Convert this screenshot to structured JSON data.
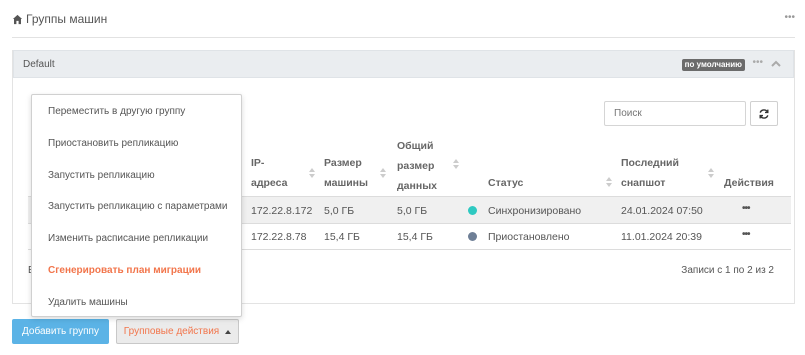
{
  "header": {
    "icon": "home-icon",
    "title": "Группы машин",
    "more": "•••"
  },
  "panel": {
    "title": "Default",
    "badge": "по умолчанию",
    "more": "•••",
    "collapse_icon": "chevron-up-icon"
  },
  "search": {
    "placeholder": "Поиск",
    "value": ""
  },
  "refresh_icon": "refresh-icon",
  "table": {
    "columns": {
      "ip": [
        "IP-",
        "адреса"
      ],
      "size": [
        "Размер",
        "машины"
      ],
      "total": [
        "Общий",
        "размер",
        "данных"
      ],
      "status": "Статус",
      "snapshot": [
        "Последний",
        "снапшот"
      ],
      "actions": "Действия"
    },
    "rows": [
      {
        "ip": "172.22.8.172",
        "size": "5,0 ГБ",
        "total": "5,0 ГБ",
        "status": "Синхронизировано",
        "status_color": "#2ec9c1",
        "snapshot": "24.01.2024 07:50",
        "actions": "•••"
      },
      {
        "ip": "172.22.8.78",
        "size": "15,4 ГБ",
        "total": "15,4 ГБ",
        "status": "Приостановлено",
        "status_color": "#6e7f96",
        "snapshot": "11.01.2024 20:39",
        "actions": "•••"
      }
    ]
  },
  "footer": {
    "partial_left": "E",
    "records": "Записи с 1 по 2 из 2"
  },
  "menu": {
    "items": [
      {
        "label": "Переместить в другую группу",
        "accent": false
      },
      {
        "label": "Приостановить репликацию",
        "accent": false
      },
      {
        "label": "Запустить репликацию",
        "accent": false
      },
      {
        "label": "Запустить репликацию с параметрами",
        "accent": false
      },
      {
        "label": "Изменить расписание репликации",
        "accent": false
      },
      {
        "label": "Сгенерировать план миграции",
        "accent": true
      },
      {
        "label": "Удалить машины",
        "accent": false
      }
    ]
  },
  "buttons": {
    "add_group": "Добавить группу",
    "group_actions": "Групповые действия"
  },
  "colors": {
    "primary": "#5bb3e6",
    "accent": "#f2754b",
    "panel_header": "#eaedf0"
  }
}
